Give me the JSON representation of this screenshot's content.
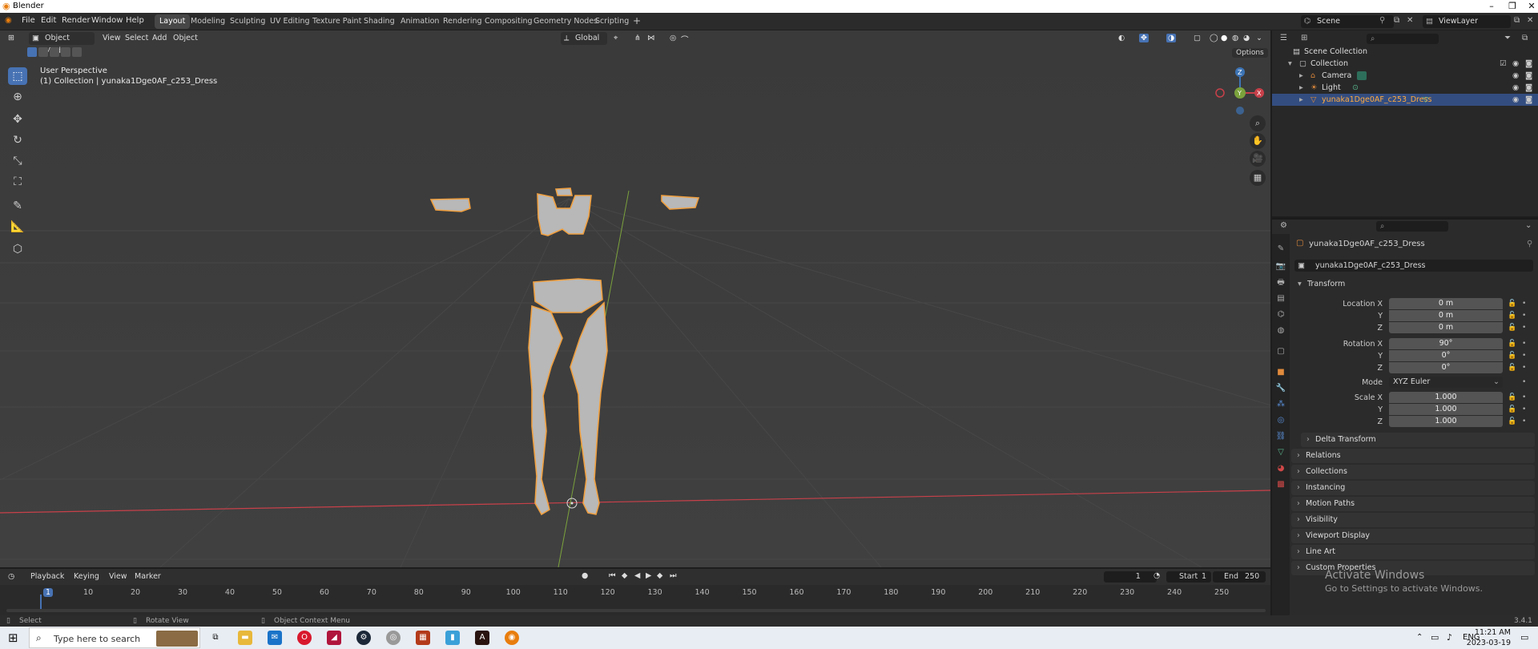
{
  "window": {
    "title": "Blender",
    "min": "–",
    "max": "❐",
    "close": "✕"
  },
  "menu": [
    "File",
    "Edit",
    "Render",
    "Window",
    "Help"
  ],
  "workspaces": [
    "Layout",
    "Modeling",
    "Sculpting",
    "UV Editing",
    "Texture Paint",
    "Shading",
    "Animation",
    "Rendering",
    "Compositing",
    "Geometry Nodes",
    "Scripting"
  ],
  "workspace_add": "+",
  "scene": {
    "name": "Scene",
    "view_layer": "ViewLayer"
  },
  "viewport": {
    "mode": "Object Mode",
    "menus": [
      "View",
      "Select",
      "Add",
      "Object"
    ],
    "orientation": "Global",
    "options": "Options",
    "perspective": "User Perspective",
    "collection_info": "(1) Collection | yunaka1Dge0AF_c253_Dress",
    "axes": {
      "x": "X",
      "y": "Y",
      "z": "Z"
    }
  },
  "outliner": {
    "root": "Scene Collection",
    "items": [
      {
        "label": "Collection"
      },
      {
        "label": "Camera"
      },
      {
        "label": "Light"
      },
      {
        "label": "yunaka1Dge0AF_c253_Dress"
      }
    ]
  },
  "properties": {
    "object_name": "yunaka1Dge0AF_c253_Dress",
    "datablock": "yunaka1Dge0AF_c253_Dress",
    "transform_title": "Transform",
    "location": {
      "label_x": "Location X",
      "label_y": "Y",
      "label_z": "Z",
      "x": "0 m",
      "y": "0 m",
      "z": "0 m"
    },
    "rotation": {
      "label_x": "Rotation X",
      "label_y": "Y",
      "label_z": "Z",
      "x": "90°",
      "y": "0°",
      "z": "0°"
    },
    "mode_label": "Mode",
    "mode": "XYZ Euler",
    "scale": {
      "label_x": "Scale X",
      "label_y": "Y",
      "label_z": "Z",
      "x": "1.000",
      "y": "1.000",
      "z": "1.000"
    },
    "panels": [
      "Delta Transform",
      "Relations",
      "Collections",
      "Instancing",
      "Motion Paths",
      "Visibility",
      "Viewport Display",
      "Line Art",
      "Custom Properties"
    ]
  },
  "timeline": {
    "menus": [
      "Playback",
      "Keying",
      "View",
      "Marker"
    ],
    "current_frame": "1",
    "start_label": "Start",
    "start": "1",
    "end_label": "End",
    "end": "250",
    "ticks": [
      "1",
      "10",
      "20",
      "30",
      "40",
      "50",
      "60",
      "70",
      "80",
      "90",
      "100",
      "110",
      "120",
      "130",
      "140",
      "150",
      "160",
      "170",
      "180",
      "190",
      "200",
      "210",
      "220",
      "230",
      "240",
      "250"
    ]
  },
  "statusbar": {
    "select": "Select",
    "rotate": "Rotate View",
    "context": "Object Context Menu",
    "version": "3.4.1"
  },
  "watermark": {
    "line1": "Activate Windows",
    "line2": "Go to Settings to activate Windows."
  },
  "taskbar": {
    "search_placeholder": "Type here to search",
    "lang": "ENG",
    "time": "11:21 AM",
    "date": "2023-03-19"
  },
  "colors": {
    "accent": "#4772b3",
    "selection_outline": "#f0a040",
    "x_axis": "#c8404a",
    "y_axis": "#7ba23c",
    "z_axis": "#3d74b5",
    "active_item": "#ffaa40"
  }
}
